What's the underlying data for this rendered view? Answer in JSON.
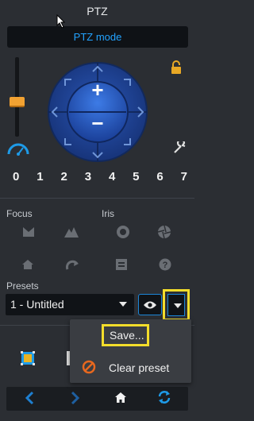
{
  "panel": {
    "title": "PTZ",
    "mode_button": "PTZ mode"
  },
  "joystick": {
    "zoom_in": "+",
    "zoom_out": "−"
  },
  "presets_numbers": [
    "0",
    "1",
    "2",
    "3",
    "4",
    "5",
    "6",
    "7"
  ],
  "labels": {
    "focus": "Focus",
    "iris": "Iris",
    "presets": "Presets"
  },
  "preset_select": {
    "value": "1 - Untitled"
  },
  "dropdown_menu": {
    "save": "Save...",
    "clear": "Clear preset"
  },
  "colors": {
    "accent_blue": "#23a3ff",
    "highlight_yellow": "#f3dd2b",
    "slider_orange": "#f2a232"
  },
  "icons": {
    "speed": "speedometer-icon",
    "lock": "lock-icon",
    "wrench": "wrench-icon",
    "eye": "eye-icon",
    "home": "home-icon",
    "refresh": "refresh-icon"
  }
}
